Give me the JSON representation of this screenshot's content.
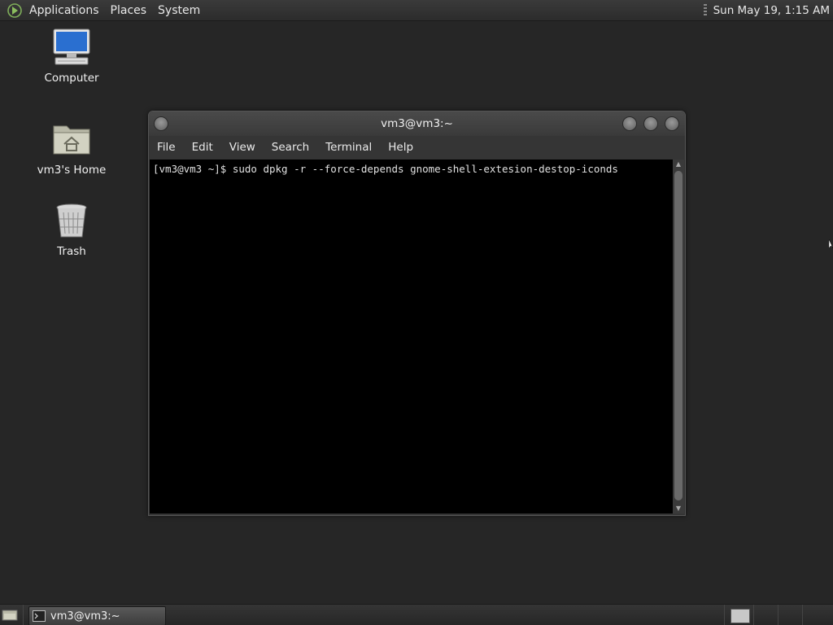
{
  "top_panel": {
    "menus": [
      "Applications",
      "Places",
      "System"
    ],
    "clock": "Sun May 19,  1:15 AM"
  },
  "desktop_icons": [
    {
      "label": "Computer",
      "icon": "computer-icon"
    },
    {
      "label": "vm3's Home",
      "icon": "home-folder-icon"
    },
    {
      "label": "Trash",
      "icon": "trash-icon"
    }
  ],
  "terminal": {
    "title": "vm3@vm3:~",
    "menus": [
      "File",
      "Edit",
      "View",
      "Search",
      "Terminal",
      "Help"
    ],
    "prompt_line": "[vm3@vm3 ~]$ sudo dpkg -r --force-depends gnome-shell-extesion-destop-iconds"
  },
  "bottom_panel": {
    "task_label": "vm3@vm3:~"
  }
}
